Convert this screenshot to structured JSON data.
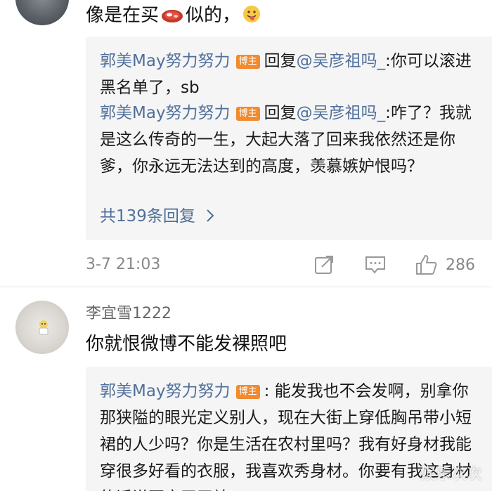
{
  "comment1": {
    "text_before": "像是在买",
    "text_after": "似的，"
  },
  "reply_box1": {
    "reply1": {
      "author": "郭美May努力努力",
      "badge": "博主",
      "prefix": "回复",
      "mention": "@吴彦祖吗_",
      "text": ":你可以滚进黑名单了，sb"
    },
    "reply2": {
      "author": "郭美May努力努力",
      "badge": "博主",
      "prefix": "回复",
      "mention": "@吴彦祖吗_",
      "text": ":咋了？我就是这么传奇的一生，大起大落了回来我依然还是你爹，你永远无法达到的高度，羡慕嫉妒恨吗？"
    },
    "more_label": "共139条回复"
  },
  "meta": {
    "time": "3-7 21:03",
    "like_count": "286"
  },
  "comment2": {
    "username": "李宜雪1222",
    "text": "你就恨微博不能发裸照吧"
  },
  "reply_box2": {
    "reply1": {
      "author": "郭美May努力努力",
      "badge": "博主",
      "text": ": 能发我也不会发啊，别拿你那狭隘的眼光定义别人，现在大街上穿低胸吊带小短裙的人少吗？你是生活在农村里吗？我有好身材我能穿很多好看的衣服，我喜欢秀身材。你要有我这身材的话说不定天天站"
    }
  },
  "watermark": "娱乐次次",
  "icons": [
    "steak-emoji",
    "tongue-face-emoji",
    "chevron-right-icon",
    "share-icon",
    "comment-icon",
    "like-icon"
  ]
}
